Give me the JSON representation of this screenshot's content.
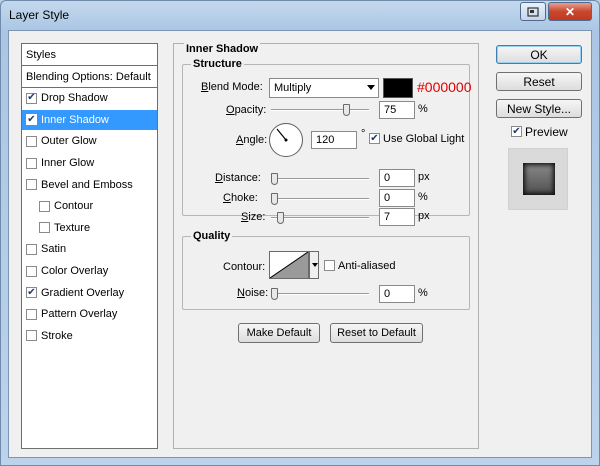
{
  "window": {
    "title": "Layer Style",
    "help_icon": "help-icon",
    "close_glyph": "✕"
  },
  "styles_list": {
    "header": "Styles",
    "blending": "Blending Options: Default",
    "items": [
      {
        "label": "Drop Shadow",
        "checked": true,
        "selected": false,
        "indent": false
      },
      {
        "label": "Inner Shadow",
        "checked": true,
        "selected": true,
        "indent": false
      },
      {
        "label": "Outer Glow",
        "checked": false,
        "selected": false,
        "indent": false
      },
      {
        "label": "Inner Glow",
        "checked": false,
        "selected": false,
        "indent": false
      },
      {
        "label": "Bevel and Emboss",
        "checked": false,
        "selected": false,
        "indent": false
      },
      {
        "label": "Contour",
        "checked": false,
        "selected": false,
        "indent": true
      },
      {
        "label": "Texture",
        "checked": false,
        "selected": false,
        "indent": true
      },
      {
        "label": "Satin",
        "checked": false,
        "selected": false,
        "indent": false
      },
      {
        "label": "Color Overlay",
        "checked": false,
        "selected": false,
        "indent": false
      },
      {
        "label": "Gradient Overlay",
        "checked": true,
        "selected": false,
        "indent": false
      },
      {
        "label": "Pattern Overlay",
        "checked": false,
        "selected": false,
        "indent": false
      },
      {
        "label": "Stroke",
        "checked": false,
        "selected": false,
        "indent": false
      }
    ]
  },
  "panel": {
    "title": "Inner Shadow",
    "structure": {
      "title": "Structure",
      "blend_mode_label": "Blend Mode:",
      "blend_mode_value": "Multiply",
      "color_hex": "#000000",
      "opacity_label": "Opacity:",
      "opacity_value": "75",
      "opacity_unit": "%",
      "angle_label": "Angle:",
      "angle_value": "120",
      "angle_unit": "°",
      "use_global_light_label": "Use Global Light",
      "use_global_light_checked": true,
      "distance_label": "Distance:",
      "distance_value": "0",
      "distance_unit": "px",
      "choke_label": "Choke:",
      "choke_value": "0",
      "choke_unit": "%",
      "size_label": "Size:",
      "size_value": "7",
      "size_unit": "px"
    },
    "quality": {
      "title": "Quality",
      "contour_label": "Contour:",
      "anti_aliased_label": "Anti-aliased",
      "anti_aliased_checked": false,
      "noise_label": "Noise:",
      "noise_value": "0",
      "noise_unit": "%"
    },
    "make_default": "Make Default",
    "reset_default": "Reset to Default"
  },
  "actions": {
    "ok": "OK",
    "reset": "Reset",
    "new_style": "New Style...",
    "preview_label": "Preview",
    "preview_checked": true
  },
  "colors": {
    "selection": "#3399ff",
    "hex_text": "#e00000",
    "swatch": "#000000"
  }
}
